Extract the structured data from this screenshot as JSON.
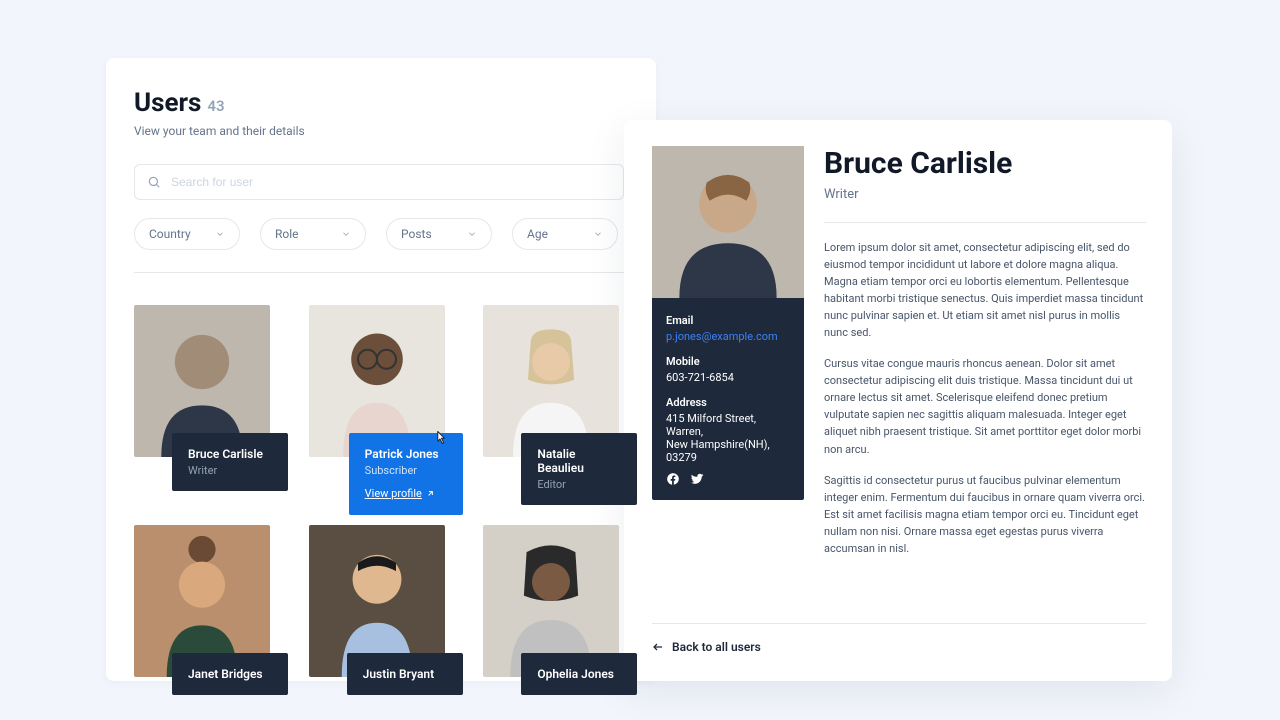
{
  "header": {
    "title": "Users",
    "count": "43",
    "subtitle": "View your team and their details"
  },
  "search": {
    "placeholder": "Search for user"
  },
  "filters": [
    {
      "label": "Country"
    },
    {
      "label": "Role"
    },
    {
      "label": "Posts"
    },
    {
      "label": "Age"
    }
  ],
  "users": [
    {
      "name": "Bruce Carlisle",
      "role": "Writer",
      "bg": "#beb7ae"
    },
    {
      "name": "Patrick Jones",
      "role": "Subscriber",
      "bg": "#e8e5de",
      "active": true,
      "view_profile": "View profile"
    },
    {
      "name": "Natalie Beaulieu",
      "role": "Editor",
      "bg": "#e7e3dc"
    },
    {
      "name": "Janet Bridges",
      "role": "",
      "bg": "#b98f6e"
    },
    {
      "name": "Justin Bryant",
      "role": "",
      "bg": "#8b7a6a"
    },
    {
      "name": "Ophelia Jones",
      "role": "",
      "bg": "#d4d0c8"
    }
  ],
  "detail": {
    "name": "Bruce Carlisle",
    "role": "Writer",
    "email_label": "Email",
    "email": "p.jones@example.com",
    "mobile_label": "Mobile",
    "mobile": "603-721-6854",
    "address_label": "Address",
    "address_line1": "415 Milford Street, Warren,",
    "address_line2": "New Hampshire(NH), 03279",
    "para1": "Lorem ipsum dolor sit amet, consectetur adipiscing elit, sed do eiusmod tempor incididunt ut labore et dolore magna aliqua. Magna etiam tempor orci eu lobortis elementum. Pellentesque habitant morbi tristique senectus. Quis imperdiet massa tincidunt nunc pulvinar sapien et. Ut etiam sit amet nisl purus in mollis nunc sed.",
    "para2": "Cursus vitae congue mauris rhoncus aenean. Dolor sit amet consectetur adipiscing elit duis tristique. Massa tincidunt dui ut ornare lectus sit amet. Scelerisque eleifend donec pretium vulputate sapien nec sagittis aliquam malesuada. Integer eget aliquet nibh praesent tristique. Sit amet porttitor eget dolor morbi non arcu.",
    "para3": "Sagittis id consectetur purus ut faucibus pulvinar elementum integer enim. Fermentum dui faucibus in ornare quam viverra orci. Est sit amet facilisis magna etiam tempor orci eu. Tincidunt eget nullam non nisi. Ornare massa eget egestas purus viverra accumsan in nisl.",
    "back": "Back to all users"
  }
}
